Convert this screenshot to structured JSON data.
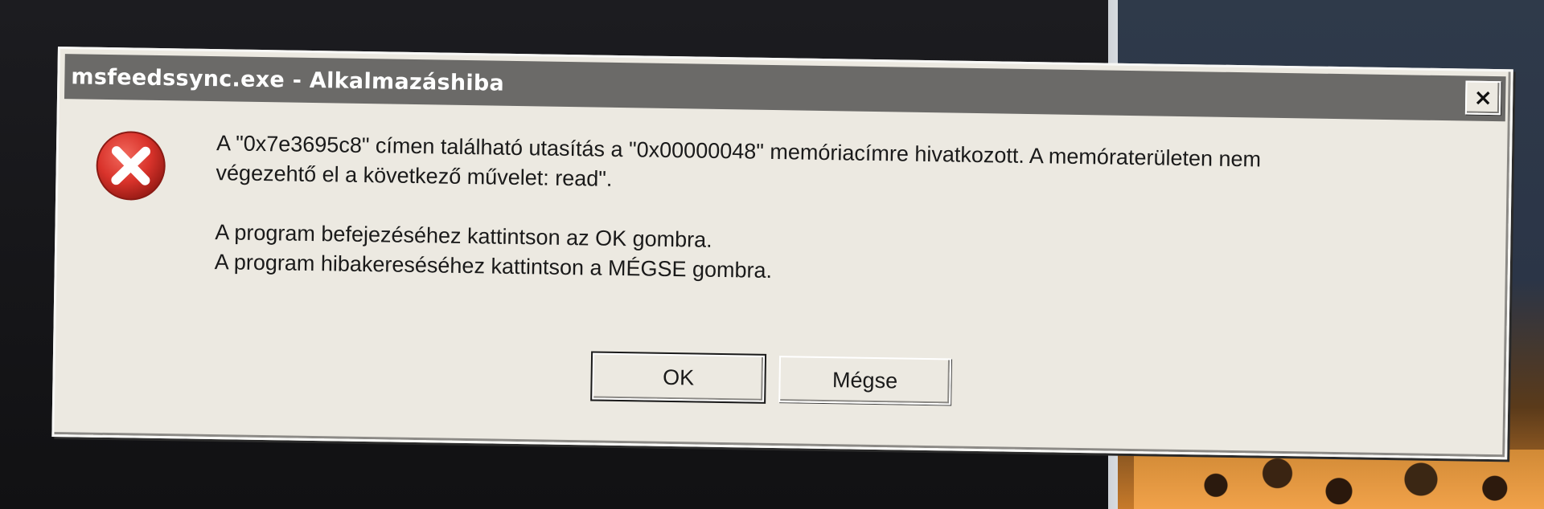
{
  "dialog": {
    "title": "msfeedssync.exe - Alkalmazáshiba",
    "close_label": "×",
    "icon": "error-icon",
    "message": {
      "line1": "A \"0x7e3695c8\" címen található utasítás a \"0x00000048\" memóriacímre hivatkozott. A memóraterületen nem",
      "line2": "végezehtő el a következő művelet: read\".",
      "line3": "A program befejezéséhez kattintson az OK gombra.",
      "line4": "A program hibakereséséhez kattintson a MÉGSE gombra."
    },
    "buttons": {
      "ok_label": "OK",
      "cancel_label": "Mégse"
    },
    "colors": {
      "titlebar": "#6b6a68",
      "window": "#ece9e1",
      "error_red": "#d9332b"
    }
  }
}
